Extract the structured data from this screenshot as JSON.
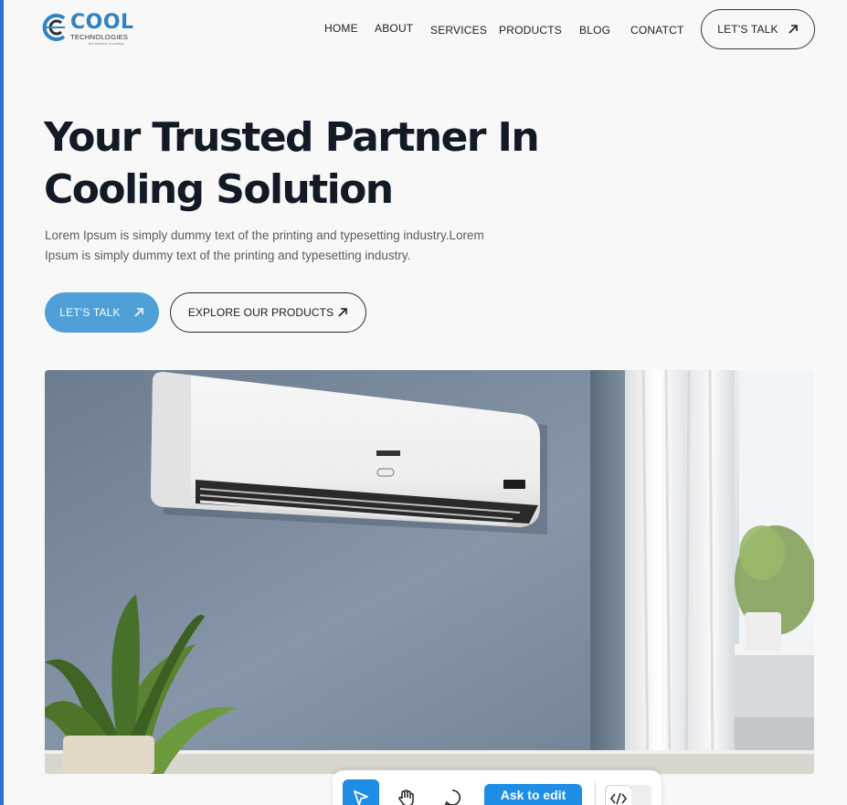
{
  "brand": {
    "name": "COOL",
    "subtitle": "TECHNOLOGIES",
    "tagline": "the science of cooling",
    "color": "#2f82c4"
  },
  "nav": {
    "items": [
      "HOME",
      "ABOUT",
      "SERVICES",
      "PRODUCTS",
      "BLOG",
      "CONATCT"
    ],
    "cta": "LET'S TALK"
  },
  "hero": {
    "title_line1": "Your Trusted Partner In",
    "title_line2": "Cooling Solution",
    "description": "Lorem Ipsum is simply dummy text of the printing and typesetting industry.Lorem Ipsum is simply dummy text of the printing and typesetting industry.",
    "primary_cta": "LET'S TALK",
    "secondary_cta": "EXPLORE OUR PRODUCTS",
    "accent": "#4ea0d6",
    "image": "air-conditioner-room-photo"
  },
  "toolbar": {
    "ask_label": "Ask to edit",
    "tools": [
      "select-cursor-icon",
      "hand-icon",
      "comment-icon",
      "code-icon"
    ],
    "accent": "#1e8de6"
  }
}
